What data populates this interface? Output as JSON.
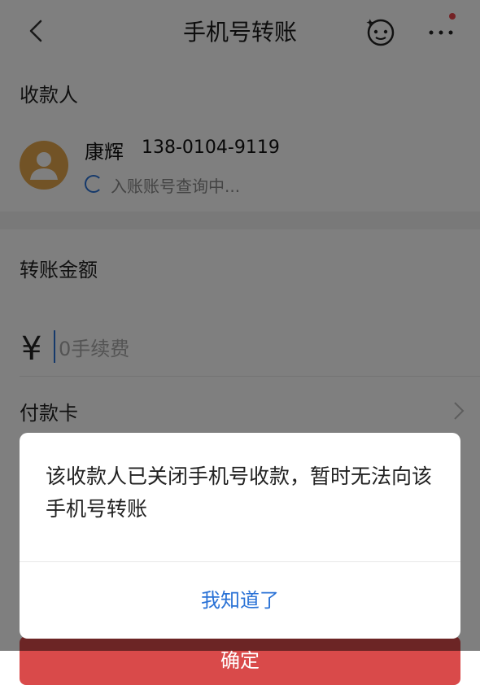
{
  "header": {
    "title": "手机号转账",
    "icons": [
      "back-arrow-icon",
      "assistant-bot-icon",
      "more-menu-icon"
    ],
    "notification_dot_color": "#e8454a"
  },
  "payee_section": {
    "label": "收款人",
    "name": "康辉",
    "phone": "138-0104-9119",
    "status": "入账账号查询中..."
  },
  "amount_section": {
    "label": "转账金额",
    "currency_symbol": "¥",
    "amount_placeholder": "0手续费",
    "amount_value": ""
  },
  "payment_card": {
    "label": "付款卡"
  },
  "confirm_button": {
    "label": "确定"
  },
  "dialog": {
    "message": "该收款人已关闭手机号收款，暂时无法向该手机号转账",
    "button_label": "我知道了"
  },
  "colors": {
    "accent_blue": "#2a72d6",
    "confirm_red": "#d94a4a",
    "avatar_orange": "#e4a64c"
  }
}
